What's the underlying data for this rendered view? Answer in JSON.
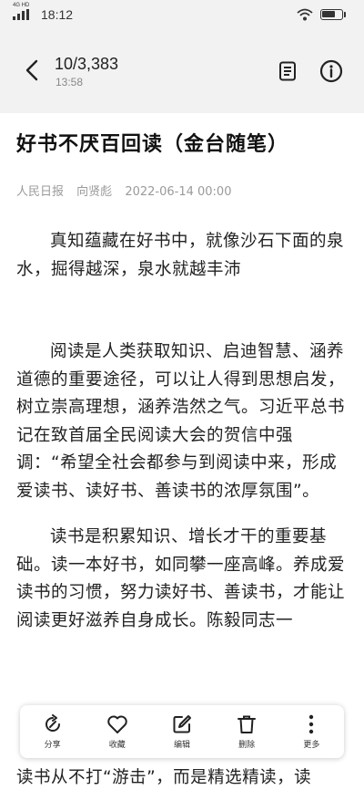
{
  "status_bar": {
    "network": "4G HD",
    "time": "18:12",
    "battery_level": 0.7
  },
  "header": {
    "count": "10/3,383",
    "time": "13:58",
    "back_icon": "back-arrow-icon",
    "doc_icon": "document-icon",
    "info_icon": "info-icon"
  },
  "article": {
    "title": "好书不厌百回读（金台随笔）",
    "source": "人民日报",
    "author": "向贤彪",
    "date": "2022-06-14 00:00",
    "paragraphs": [
      "真知蕴藏在好书中，就像沙石下面的泉水，掘得越深，泉水就越丰沛",
      "阅读是人类获取知识、启迪智慧、涵养道德的重要途径，可以让人得到思想启发，树立崇高理想，涵养浩然之气。习近平总书记在致首届全民阅读大会的贺信中强调：“希望全社会都参与到阅读中来，形成爱读书、读好书、善读书的浓厚氛围”。",
      "读书是积累知识、增长才干的重要基础。读一本好书，如同攀一座高峰。养成爱读书的习惯，努力读好书、善读书，才能让阅读更好滋养自身成长。陈毅同志一"
    ],
    "bottom_line": "读书从不打“游击”，而是精选精读，读"
  },
  "toolbar": {
    "items": [
      {
        "label": "分享",
        "icon": "share-icon"
      },
      {
        "label": "收藏",
        "icon": "heart-icon"
      },
      {
        "label": "编辑",
        "icon": "edit-icon"
      },
      {
        "label": "删除",
        "icon": "trash-icon"
      },
      {
        "label": "更多",
        "icon": "more-icon"
      }
    ]
  }
}
